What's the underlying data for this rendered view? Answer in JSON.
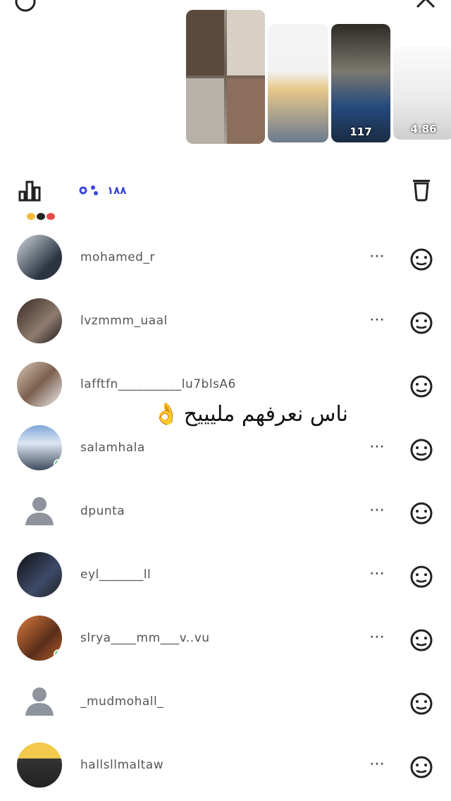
{
  "thumbnails": [
    {
      "views": ""
    },
    {
      "views": ""
    },
    {
      "views": "117"
    },
    {
      "views": "4.86"
    }
  ],
  "toolbar": {
    "viewer_count": "١٨٨"
  },
  "viewers": [
    {
      "username": "mohamed_r",
      "online": false,
      "placeholder": false,
      "has_more": true
    },
    {
      "username": "lvzmmm_uaal",
      "online": false,
      "placeholder": false,
      "has_more": true
    },
    {
      "username": "lafftfn__________lu7blsA6",
      "online": false,
      "placeholder": false,
      "has_more": false
    },
    {
      "username": "salamhala",
      "online": true,
      "placeholder": false,
      "has_more": true
    },
    {
      "username": "dpunta",
      "online": false,
      "placeholder": true,
      "has_more": true
    },
    {
      "username": "eyl_______ll",
      "online": false,
      "placeholder": false,
      "has_more": true
    },
    {
      "username": "slrya____mm___v..vu",
      "online": true,
      "placeholder": false,
      "has_more": true
    },
    {
      "username": "_mudmohall_",
      "online": false,
      "placeholder": true,
      "has_more": false
    },
    {
      "username": "hallsllmaltaw",
      "online": false,
      "placeholder": false,
      "has_more": true
    }
  ],
  "overlay": {
    "text": "ناس نعرفهم مليييح",
    "emoji": "👌"
  },
  "colors": {
    "accent": "#3b46d9",
    "online": "#16b94a"
  }
}
